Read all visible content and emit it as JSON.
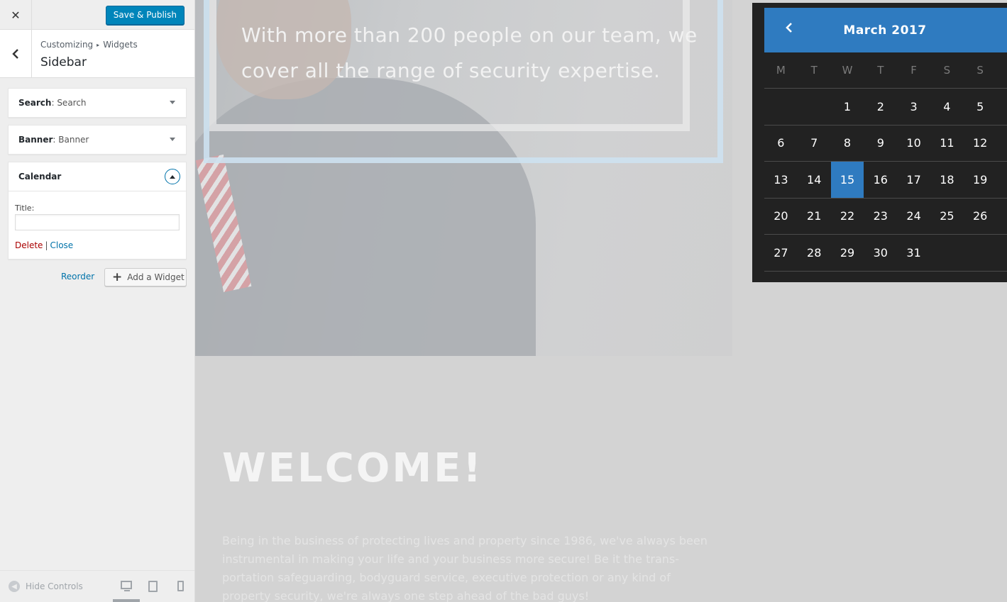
{
  "customizer": {
    "close_icon": "close-icon",
    "save_label": "Save & Publish",
    "breadcrumb": {
      "root": "Customizing",
      "separator": "▸",
      "current": "Widgets"
    },
    "section_title": "Sidebar",
    "widgets": [
      {
        "type": "Search",
        "name": "Search",
        "expanded": false
      },
      {
        "type": "Banner",
        "name": "Banner",
        "expanded": false
      },
      {
        "type": "Calendar",
        "name": "",
        "expanded": true
      }
    ],
    "calendar_form": {
      "title_label": "Title:",
      "title_value": "",
      "delete_label": "Delete",
      "separator": "|",
      "close_label": "Close"
    },
    "reorder_label": "Reorder",
    "add_widget_label": "Add a Widget",
    "footer": {
      "hide_controls_label": "Hide Controls",
      "devices": [
        "desktop",
        "tablet",
        "mobile"
      ],
      "active_device": "desktop"
    }
  },
  "preview": {
    "hero_text": "With more than 200 people on our team, we cover all the range of security expertise.",
    "welcome_heading": "WELCOME!",
    "intro_text": "Being in the business of protecting lives and property since 1986, we've always been instrumental in making your life and your business more secure! Be it the trans-portation safeguarding, bodyguard service, executive protection or any kind of property security, we're always one step ahead of the bad guys!",
    "calendar": {
      "month": "March 2017",
      "days_of_week": [
        "M",
        "T",
        "W",
        "T",
        "F",
        "S",
        "S"
      ],
      "weeks": [
        [
          "",
          "",
          "1",
          "2",
          "3",
          "4",
          "5"
        ],
        [
          "6",
          "7",
          "8",
          "9",
          "10",
          "11",
          "12"
        ],
        [
          "13",
          "14",
          "15",
          "16",
          "17",
          "18",
          "19"
        ],
        [
          "20",
          "21",
          "22",
          "23",
          "24",
          "25",
          "26"
        ],
        [
          "27",
          "28",
          "29",
          "30",
          "31",
          "",
          ""
        ]
      ],
      "today": "15",
      "colors": {
        "header": "#2f7bc0",
        "background": "#222222",
        "today": "#2f7bc0"
      }
    }
  },
  "colors": {
    "accent": "#0085ba",
    "link": "#0073aa",
    "delete": "#aa0000"
  }
}
